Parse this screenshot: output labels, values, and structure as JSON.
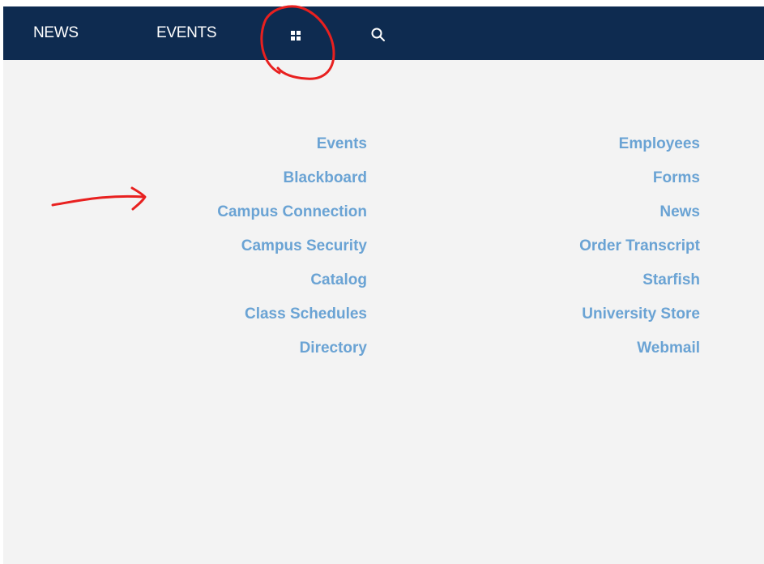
{
  "topnav": {
    "items": [
      {
        "label": "NEWS"
      },
      {
        "label": "EVENTS"
      }
    ],
    "grid_icon": "grid-dots-icon",
    "search_icon": "search-icon"
  },
  "links": {
    "left": [
      {
        "label": "Events"
      },
      {
        "label": "Blackboard"
      },
      {
        "label": "Campus Connection"
      },
      {
        "label": "Campus Security"
      },
      {
        "label": "Catalog"
      },
      {
        "label": "Class Schedules"
      },
      {
        "label": "Directory"
      }
    ],
    "right": [
      {
        "label": "Employees"
      },
      {
        "label": "Forms"
      },
      {
        "label": "News"
      },
      {
        "label": "Order Transcript"
      },
      {
        "label": "Starfish"
      },
      {
        "label": "University Store"
      },
      {
        "label": "Webmail"
      }
    ]
  },
  "colors": {
    "topbar": "#0e2b50",
    "link": "#6aa3d4",
    "background": "#f3f3f3",
    "annotation": "#e8201f"
  }
}
